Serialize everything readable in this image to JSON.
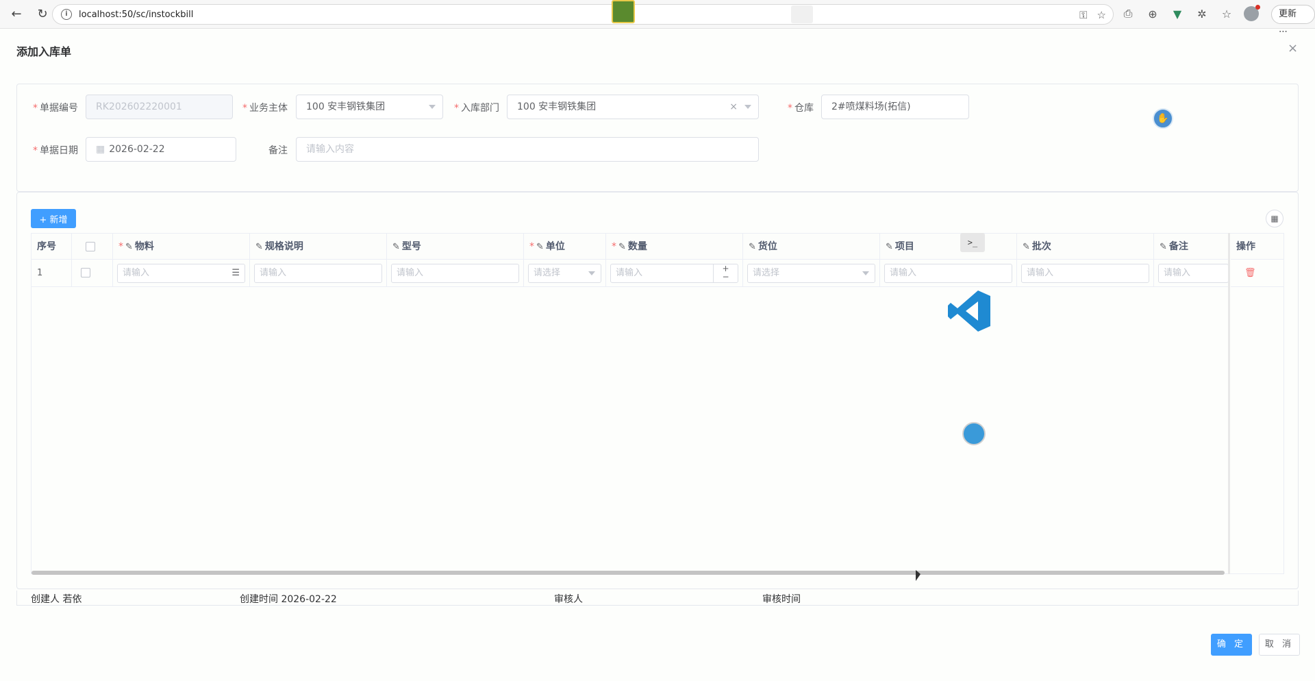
{
  "browser": {
    "url": "localhost:50/sc/instockbill",
    "update_label": "更新"
  },
  "dialog": {
    "title": "添加入库单",
    "close": "×"
  },
  "form": {
    "bill_no": {
      "label": "单据编号",
      "value": "RK202602220001"
    },
    "entity": {
      "label": "业务主体",
      "value": "100 安丰钢铁集团"
    },
    "dept": {
      "label": "入库部门",
      "value": "100 安丰钢铁集团"
    },
    "warehouse": {
      "label": "仓库",
      "value": "2#喷煤料场(拓信)"
    },
    "date": {
      "label": "单据日期",
      "value": "2026-02-22"
    },
    "remark": {
      "label": "备注",
      "placeholder": "请输入内容"
    }
  },
  "toolbar": {
    "add_label": "+ 新增"
  },
  "table": {
    "headers": {
      "seq": "序号",
      "material": "物料",
      "spec": "规格说明",
      "model": "型号",
      "unit": "单位",
      "qty": "数量",
      "location": "货位",
      "project": "项目",
      "batch": "批次",
      "note": "备注",
      "action": "操作"
    },
    "rows": [
      {
        "seq": "1",
        "material_ph": "请输入",
        "spec_ph": "请输入",
        "model_ph": "请输入",
        "unit_ph": "请选择",
        "qty_ph": "请输入",
        "location_ph": "请选择",
        "project_ph": "请输入",
        "batch_ph": "请输入",
        "note_ph": "请输入"
      }
    ]
  },
  "meta": {
    "creator": "创建人 若依",
    "created_time": "创建时间 2026-02-22",
    "reviewer": "审核人",
    "review_time": "审核时间"
  },
  "footer": {
    "ok_label": "确 定",
    "cancel_label": "取 消"
  },
  "colors": {
    "primary": "#409eff",
    "required": "#f56c6c"
  }
}
